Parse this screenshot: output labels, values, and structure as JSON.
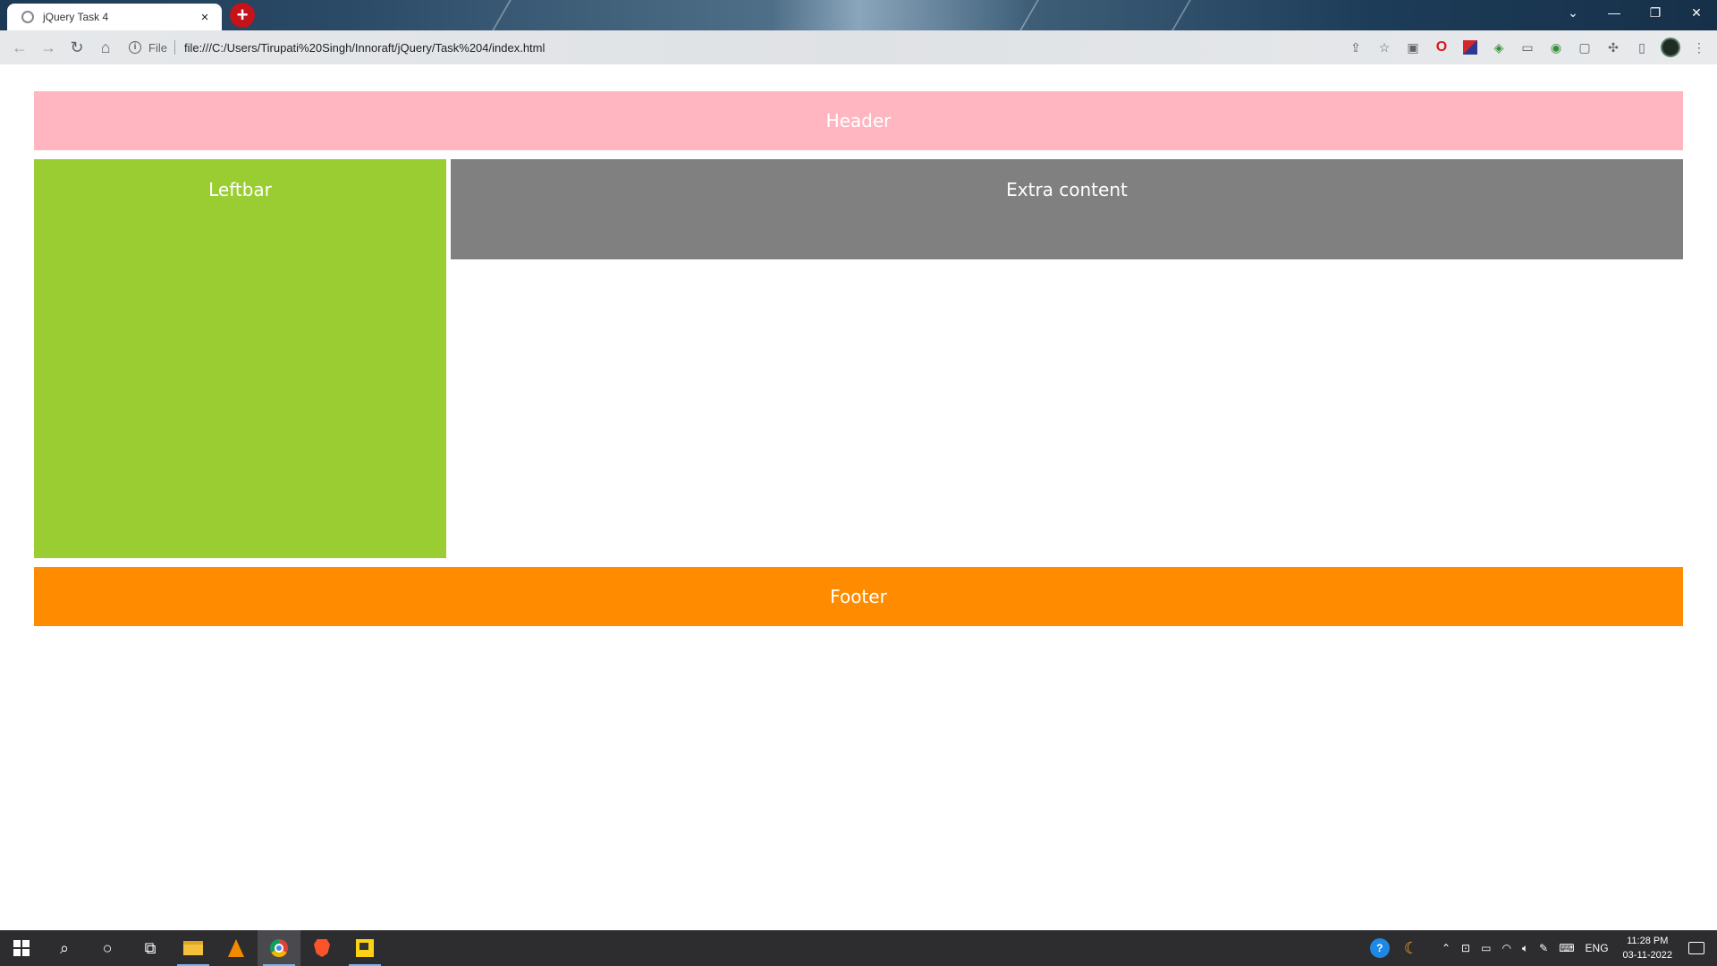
{
  "browser": {
    "tab_title": "jQuery Task 4",
    "tab_close": "×",
    "new_tab": "+",
    "scheme": "File",
    "url": "file:///C:/Users/Tirupati%20Singh/Innoraft/jQuery/Task%204/index.html",
    "window_controls": {
      "minimize": "—",
      "restore": "❐",
      "close": "✕",
      "tab_search": "⌄"
    }
  },
  "page": {
    "header": "Header",
    "leftbar": "Leftbar",
    "extra": "Extra content",
    "footer": "Footer"
  },
  "taskbar": {
    "language": "ENG",
    "time": "11:28 PM",
    "date": "03-11-2022"
  },
  "colors": {
    "header": "#ffb6c1",
    "leftbar": "#9acd32",
    "extra": "#808080",
    "footer": "#ff8c00"
  }
}
